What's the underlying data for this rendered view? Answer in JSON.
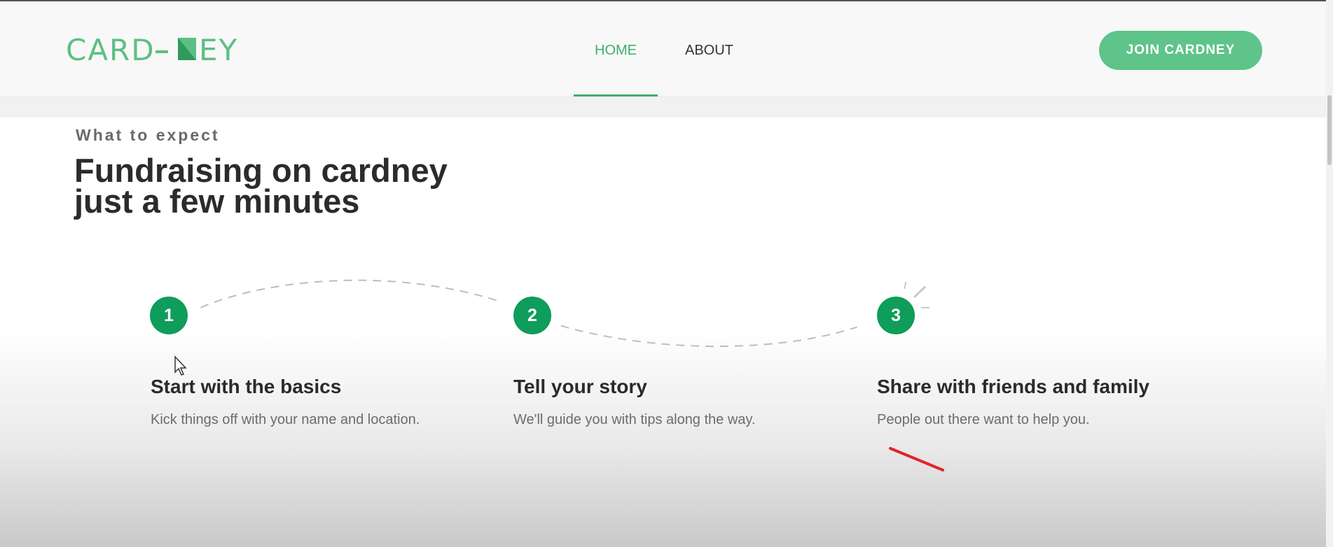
{
  "brand": {
    "logo_text": "CARD-NEY",
    "accent": "#5cbf83",
    "step_color": "#0e9d5a"
  },
  "nav": {
    "home": "HOME",
    "about": "ABOUT",
    "active": "HOME"
  },
  "header": {
    "join_label": "JOIN CARDNEY"
  },
  "section": {
    "eyebrow": "What to expect",
    "headline_line1": "Fundraising on cardney",
    "headline_line2": "just a few minutes"
  },
  "steps": [
    {
      "number": "1",
      "title": "Start with the basics",
      "description": "Kick things off with your name and location."
    },
    {
      "number": "2",
      "title": "Tell your story",
      "description": "We'll guide you with tips along the way."
    },
    {
      "number": "3",
      "title": "Share with friends and family",
      "description": "People out there want to help you."
    }
  ],
  "icons": {
    "cursor": "mouse-pointer-icon",
    "annotation": "red-pen-stroke",
    "sparkle": "sparkle-icon"
  }
}
